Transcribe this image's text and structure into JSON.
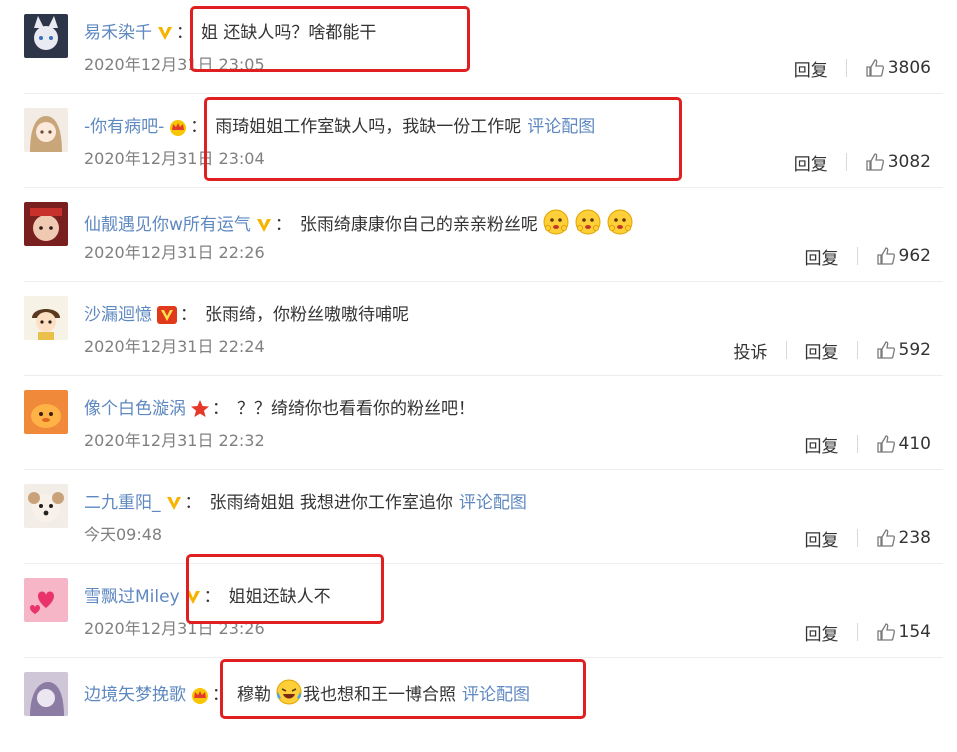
{
  "comments": [
    {
      "user": "易禾染千",
      "badge": "v-yellow",
      "text": "姐 还缺人吗？啥都能干",
      "link": "",
      "time": "2020年12月31日 23:05",
      "actions": [
        "回复"
      ],
      "likes": "3806"
    },
    {
      "user": "-你有病吧-",
      "badge": "crown",
      "text": "雨琦姐姐工作室缺人吗，我缺一份工作呢",
      "link": "评论配图",
      "time": "2020年12月31日 23:04",
      "actions": [
        "回复"
      ],
      "likes": "3082"
    },
    {
      "user": "仙靓遇见你w所有运气",
      "badge": "v-yellow",
      "text": "张雨绮康康你自己的亲亲粉丝呢",
      "link": "",
      "emoji_count": 3,
      "time": "2020年12月31日 22:26",
      "actions": [
        "回复"
      ],
      "likes": "962"
    },
    {
      "user": "沙漏迴憶",
      "badge": "v-red",
      "text": "张雨绮，你粉丝嗷嗷待哺呢",
      "link": "",
      "time": "2020年12月31日 22:24",
      "actions": [
        "投诉",
        "回复"
      ],
      "likes": "592"
    },
    {
      "user": "像个白色漩涡",
      "badge": "star",
      "text": "？？绮绮你也看看你的粉丝吧！",
      "link": "",
      "time": "2020年12月31日 22:32",
      "actions": [
        "回复"
      ],
      "likes": "410"
    },
    {
      "user": "二九重阳_",
      "badge": "v-yellow",
      "text": "张雨绮姐姐 我想进你工作室追你",
      "link": "评论配图",
      "time": "今天09:48",
      "actions": [
        "回复"
      ],
      "likes": "238"
    },
    {
      "user": "雪飘过Miley",
      "badge": "v-yellow",
      "text": "姐姐还缺人不",
      "link": "",
      "time": "2020年12月31日 23:26",
      "actions": [
        "回复"
      ],
      "likes": "154"
    },
    {
      "user": "边境矢梦挽歌",
      "badge": "crown",
      "text_before": "穆勒",
      "text": "我也想和王一博合照",
      "link": "评论配图",
      "time": "",
      "actions": [],
      "likes": ""
    }
  ],
  "colors": {
    "username": "#5e88c0",
    "text": "#333333",
    "time": "#808080",
    "highlight": "#e02020"
  },
  "icons": {
    "like": "thumbs-up-icon",
    "emoji": "smiling-face-emoji",
    "laugh": "laughing-tears-emoji"
  }
}
